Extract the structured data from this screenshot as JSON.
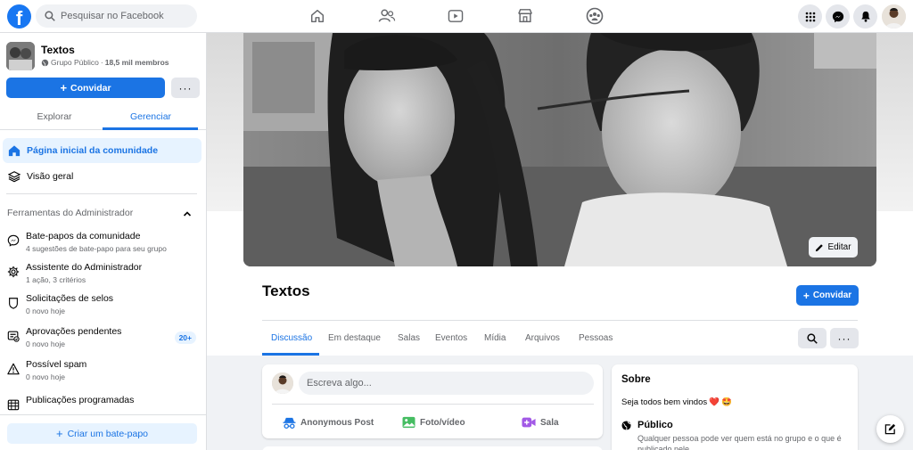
{
  "topbar": {
    "logo_letter": "f",
    "search_placeholder": "Pesquisar no Facebook"
  },
  "group": {
    "name": "Textos",
    "privacy": "Grupo Público",
    "separator": "·",
    "members": "18,5 mil membros",
    "invite_label": "Convidar",
    "more_label": "···"
  },
  "sidebar": {
    "tabs": [
      {
        "label": "Explorar",
        "active": false
      },
      {
        "label": "Gerenciar",
        "active": true
      }
    ],
    "nav": [
      {
        "label": "Página inicial da comunidade",
        "icon": "home-icon",
        "active": true
      },
      {
        "label": "Visão geral",
        "icon": "layers-icon",
        "active": false
      }
    ],
    "admin_heading": "Ferramentas do Administrador",
    "tools": [
      {
        "title": "Bate-papos da comunidade",
        "subtitle": "4 sugestões de bate-papo para seu grupo",
        "icon": "messenger-icon"
      },
      {
        "title": "Assistente do Administrador",
        "subtitle": "1 ação, 3 critérios",
        "icon": "gear-icon"
      },
      {
        "title": "Solicitações de selos",
        "subtitle": "0 novo hoje",
        "icon": "shield-icon"
      },
      {
        "title": "Aprovações pendentes",
        "subtitle": "0 novo hoje",
        "icon": "approvals-icon",
        "badge": "20+"
      },
      {
        "title": "Possível spam",
        "subtitle": "0 novo hoje",
        "icon": "warning-icon"
      },
      {
        "title": "Publicações programadas",
        "subtitle": "",
        "icon": "calendar-icon"
      }
    ],
    "create_chat_label": "Criar um bate-papo"
  },
  "main": {
    "edit_label": "Editar",
    "title": "Textos",
    "invite_label": "Convidar",
    "tabs": [
      {
        "label": "Discussão",
        "active": true
      },
      {
        "label": "Em destaque",
        "active": false
      },
      {
        "label": "Salas",
        "active": false
      },
      {
        "label": "Eventos",
        "active": false
      },
      {
        "label": "Mídia",
        "active": false
      },
      {
        "label": "Arquivos",
        "active": false
      },
      {
        "label": "Pessoas",
        "active": false
      }
    ],
    "more_label": "···"
  },
  "composer": {
    "placeholder": "Escreva algo...",
    "actions": [
      {
        "label": "Anonymous Post",
        "icon": "incognito-icon",
        "color": "#1b74e4"
      },
      {
        "label": "Foto/vídeo",
        "icon": "photo-icon",
        "color": "#45bd62"
      },
      {
        "label": "Sala",
        "icon": "room-icon",
        "color": "#a259e6"
      }
    ]
  },
  "about": {
    "title": "Sobre",
    "description": "Seja todos bem vindos",
    "emoji_heart": "❤️",
    "emoji_face": "🤩",
    "privacy_title": "Público",
    "privacy_description": "Qualquer pessoa pode ver quem está no grupo e o que é publicado nele."
  },
  "colors": {
    "brand": "#1877f2",
    "accent": "#1b74e4",
    "background": "#f0f2f5"
  }
}
